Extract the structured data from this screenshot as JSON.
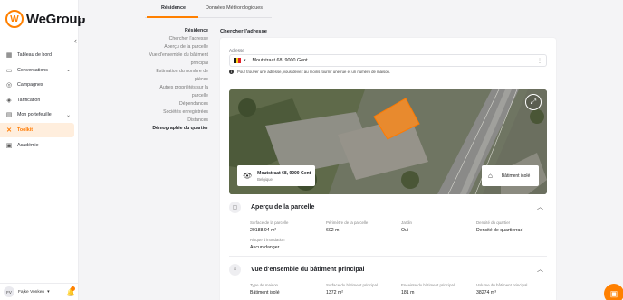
{
  "brand": {
    "name": "WeGroup",
    "logo_letters": "W",
    "accent": "#ff8000"
  },
  "sidebar": {
    "items": [
      {
        "label": "Tableau de bord",
        "icon": "dashboard-icon",
        "glyph": "▦",
        "chevron": false
      },
      {
        "label": "Conversations",
        "icon": "chat-icon",
        "glyph": "▭",
        "chevron": true
      },
      {
        "label": "Campagnes",
        "icon": "globe-icon",
        "glyph": "◎",
        "chevron": false
      },
      {
        "label": "Tarification",
        "icon": "pricing-icon",
        "glyph": "◈",
        "chevron": false
      },
      {
        "label": "Mon portefeuille",
        "icon": "portfolio-icon",
        "glyph": "▤",
        "chevron": true
      },
      {
        "label": "Toolkit",
        "icon": "toolkit-icon",
        "glyph": "✕",
        "chevron": false,
        "active": true
      },
      {
        "label": "Académie",
        "icon": "academy-icon",
        "glyph": "▣",
        "chevron": false
      }
    ],
    "user": {
      "initials": "FV",
      "name": "Fajke Vonken"
    }
  },
  "tabs": [
    {
      "label": "Résidence",
      "active": true
    },
    {
      "label": "Données Météorologiques",
      "active": false
    }
  ],
  "section_nav": [
    {
      "label": "Résidence",
      "strong": true
    },
    {
      "label": "Chercher l'adresse",
      "strong": false
    },
    {
      "label": "Aperçu de la parcelle",
      "strong": false
    },
    {
      "label": "Vue d'ensemble du bâtiment",
      "strong": false
    },
    {
      "label": "principal",
      "strong": false
    },
    {
      "label": "Estimation du nombre de",
      "strong": false
    },
    {
      "label": "pièces",
      "strong": false
    },
    {
      "label": "Autres propriétés sur la",
      "strong": false
    },
    {
      "label": "parcelle",
      "strong": false
    },
    {
      "label": "Dépendances",
      "strong": false
    },
    {
      "label": "Sociétés enregistrées",
      "strong": false
    },
    {
      "label": "Distances",
      "strong": false
    },
    {
      "label": "Démographie du quartier",
      "strong": true
    }
  ],
  "main": {
    "title": "Chercher l'adresse",
    "address_label": "Adresse",
    "address_value": "Moutstraat 68, 9000 Gent",
    "hint": "Pour trouver une adresse, vous devez au moins fournir une rue et un numéro de maison."
  },
  "map": {
    "address_line1": "Moutstraat 68, 9000 Gent",
    "address_line2": "Belgique",
    "building_label": "Bâtiment isolé"
  },
  "parcel": {
    "title": "Aperçu de la parcelle",
    "fields": [
      {
        "label": "Surface de la parcelle",
        "value": "20188.94 m²"
      },
      {
        "label": "Périmètre de la parcelle",
        "value": "602 m"
      },
      {
        "label": "Jardin",
        "value": "Oui"
      },
      {
        "label": "Densité du quartier",
        "value": "Densité de quartierrad"
      },
      {
        "label": "Risque d'inondation",
        "value": "Aucun danger"
      }
    ]
  },
  "building": {
    "title": "Vue d'ensemble du bâtiment principal",
    "fields": [
      {
        "label": "Type de maison",
        "value": "Bâtiment isolé"
      },
      {
        "label": "Surface du bâtiment principal",
        "value": "1372 m²"
      },
      {
        "label": "Enceinte du bâtiment principal",
        "value": "181 m"
      },
      {
        "label": "Volume du bâtiment principal",
        "value": "38274 m³"
      }
    ]
  }
}
